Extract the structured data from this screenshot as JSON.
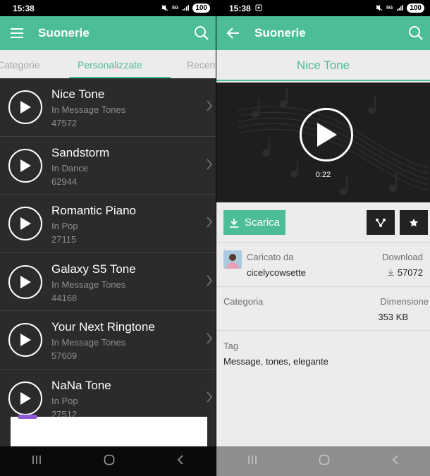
{
  "left": {
    "status": {
      "time": "15:38",
      "battery": "100"
    },
    "appbar": {
      "title": "Suonerie"
    },
    "tabs": [
      {
        "label": "Categorie"
      },
      {
        "label": "Personalizzate"
      },
      {
        "label": "Recent"
      }
    ],
    "ringtones": [
      {
        "title": "Nice Tone",
        "category": "In Message Tones",
        "count": "47572"
      },
      {
        "title": "Sandstorm",
        "category": "In Dance",
        "count": "62944"
      },
      {
        "title": "Romantic Piano",
        "category": "In Pop",
        "count": "27115"
      },
      {
        "title": "Galaxy S5 Tone",
        "category": "In Message Tones",
        "count": "44168"
      },
      {
        "title": "Your Next Ringtone",
        "category": "In Message Tones",
        "count": "57609"
      },
      {
        "title": "NaNa Tone",
        "category": "In Pop",
        "count": "27512"
      }
    ]
  },
  "right": {
    "status": {
      "time": "15:38",
      "battery": "100"
    },
    "appbar": {
      "title": "Suonerie"
    },
    "tone_name": "Nice Tone",
    "duration": "0:22",
    "download_button": "Scarica",
    "uploaded_label": "Caricato da",
    "uploader": "cicelycowsette",
    "downloads_label": "Download",
    "downloads_value": "57072",
    "category_label": "Categoria",
    "size_label": "Dimensione",
    "size_value": "353 KB",
    "tag_label": "Tag",
    "tag_value": "Message, tones, elegante"
  },
  "colors": {
    "accent": "#4dbc98",
    "dark": "#2b2b2b"
  }
}
